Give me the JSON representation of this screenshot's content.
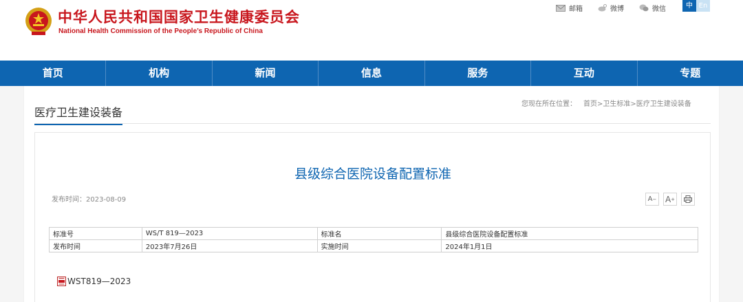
{
  "header": {
    "site_title": "中华人民共和国国家卫生健康委员会",
    "site_subtitle": "National Health Commission of the People’s Republic of China"
  },
  "toplinks": [
    {
      "label": "邮箱",
      "icon": "mail-icon"
    },
    {
      "label": "微博",
      "icon": "weibo-icon"
    },
    {
      "label": "微信",
      "icon": "wechat-icon"
    }
  ],
  "lang": {
    "zh": "中",
    "en": "En"
  },
  "nav": [
    "首页",
    "机构",
    "新闻",
    "信息",
    "服务",
    "互动",
    "专题"
  ],
  "section": {
    "title": "医疗卫生建设装备"
  },
  "breadcrumb": {
    "label": "您现在所在位置：",
    "items": [
      "首页",
      "卫生标准",
      "医疗卫生建设装备"
    ],
    "separator": ">"
  },
  "article": {
    "title": "县级综合医院设备配置标准",
    "pub_label": "发布时间：",
    "pub_date": "2023-08-09"
  },
  "tools": {
    "font_small": "A",
    "font_large": "A"
  },
  "meta": {
    "rows": [
      [
        "标准号",
        "WS/T 819—2023",
        "标准名",
        "县级综合医院设备配置标准"
      ],
      [
        "发布时间",
        "2023年7月26日",
        "实施时间",
        "2024年1月1日"
      ]
    ]
  },
  "attachment": {
    "label": "WST819—2023",
    "icon": "pdf-icon"
  },
  "colors": {
    "brand_red": "#c8161d",
    "nav_blue": "#0e65b1"
  }
}
